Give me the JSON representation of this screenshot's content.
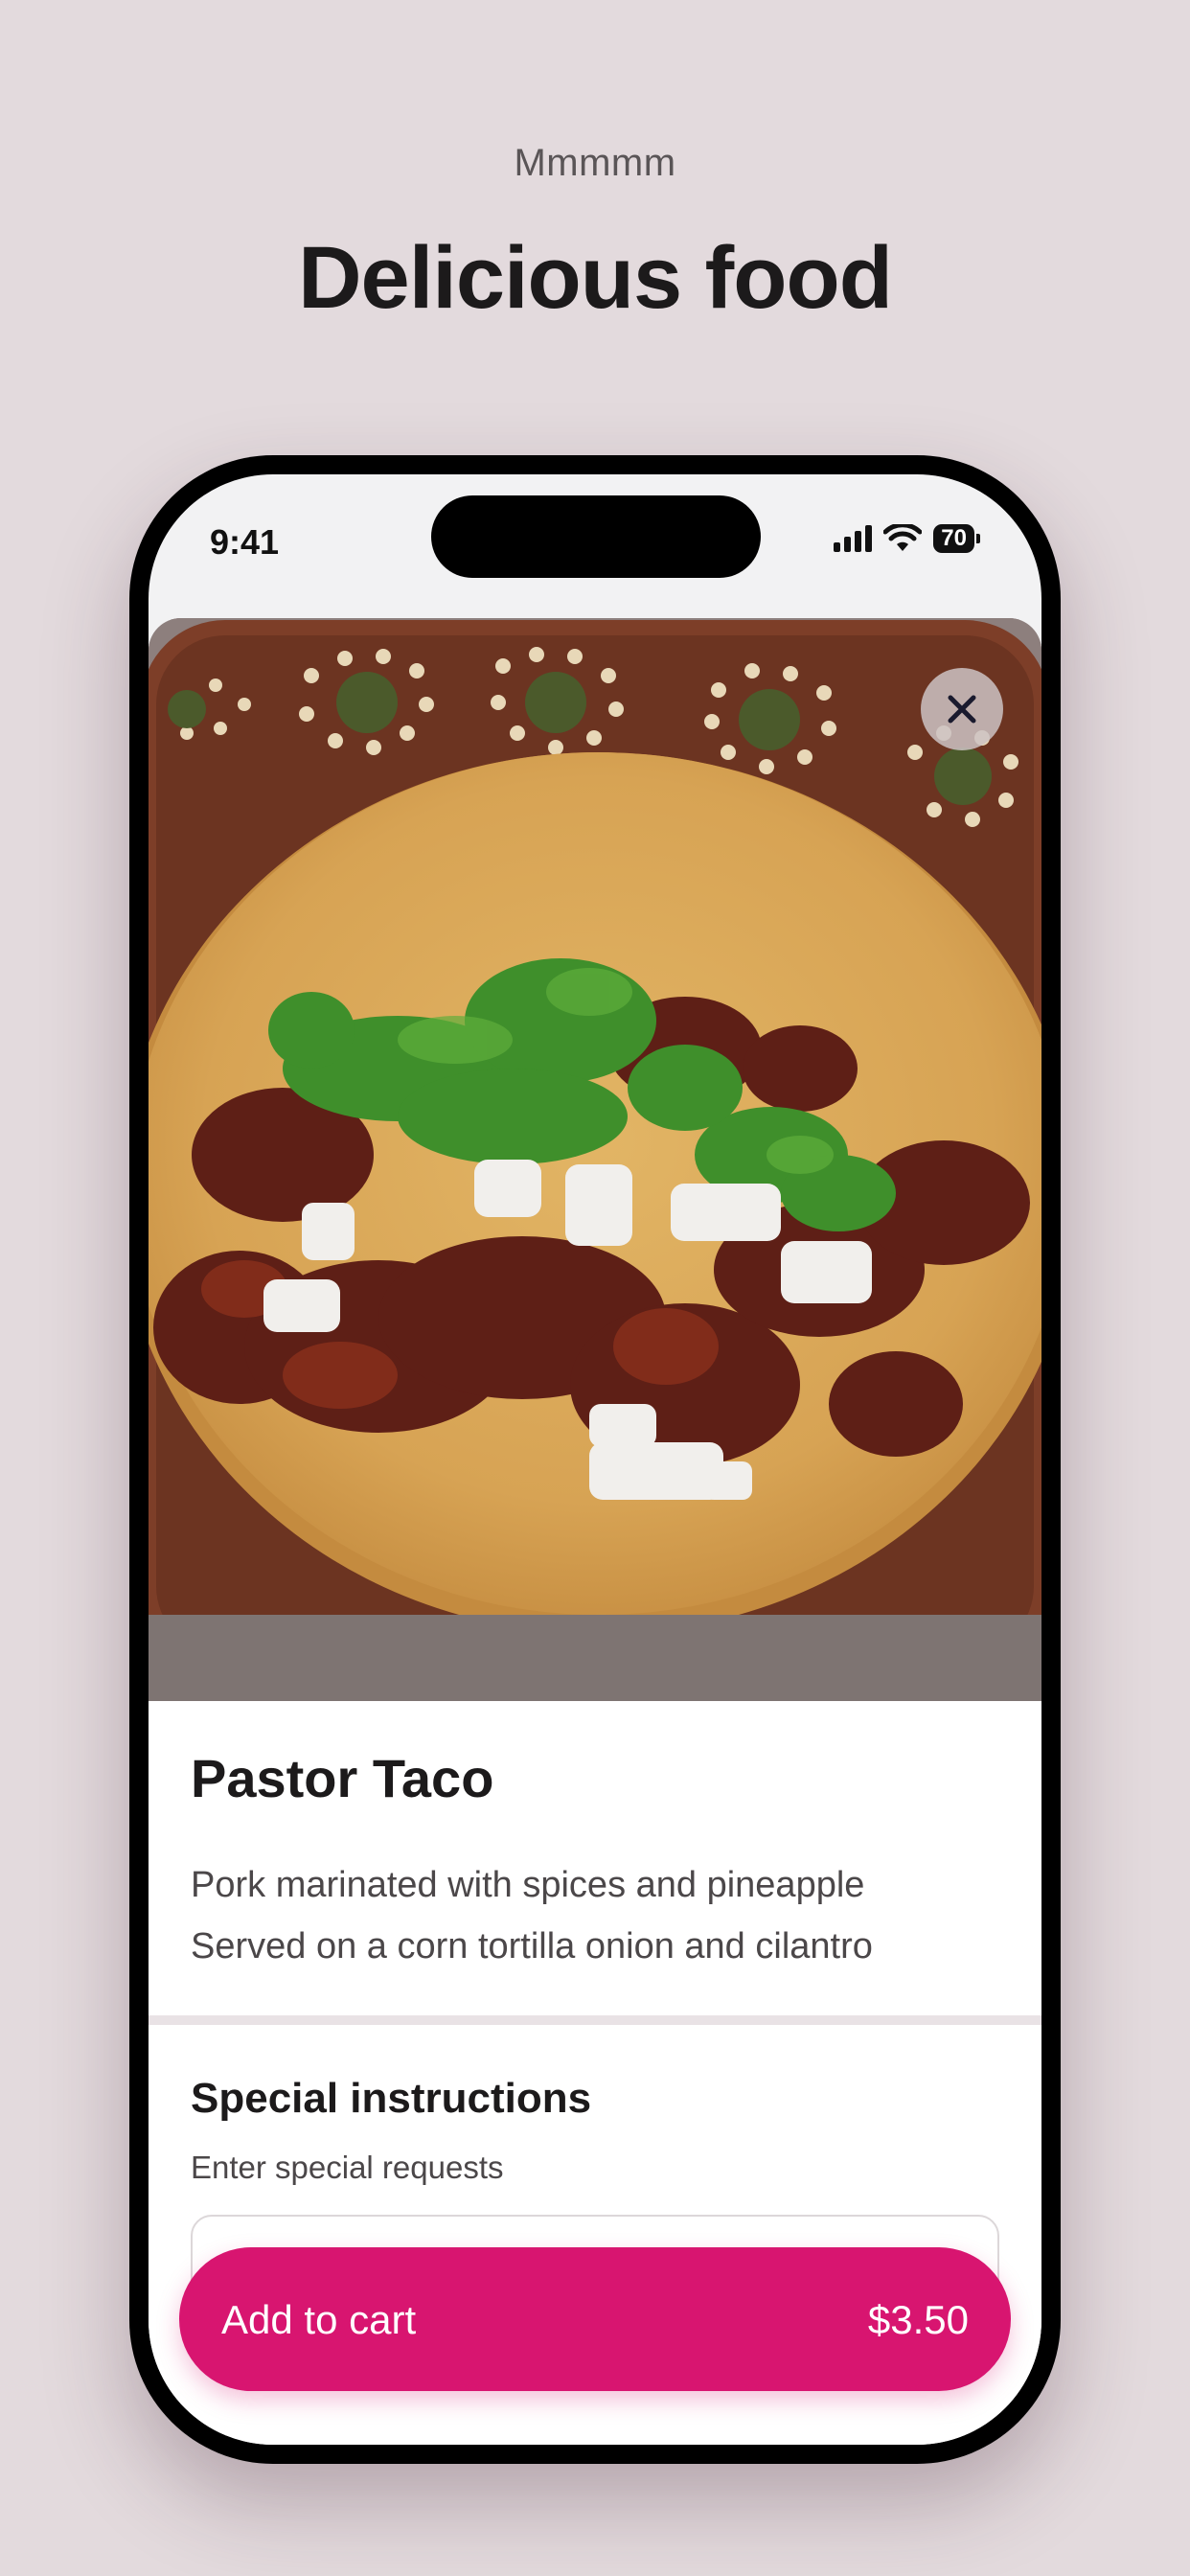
{
  "page": {
    "eyebrow": "Mmmmm",
    "headline": "Delicious food"
  },
  "status_bar": {
    "time": "9:41",
    "battery": "70",
    "icons": [
      "signal-icon",
      "wifi-icon",
      "battery-icon"
    ]
  },
  "item": {
    "image_alt": "Pastor taco on a clay plate",
    "title": "Pastor Taco",
    "description_lines": [
      "Pork marinated with spices and pineapple",
      "Served on a corn tortilla onion and cilantro"
    ]
  },
  "special_instructions": {
    "title": "Special instructions",
    "hint": "Enter special requests",
    "value": ""
  },
  "cart": {
    "label": "Add to cart",
    "price": "$3.50"
  },
  "colors": {
    "background": "#e3dadd",
    "accent": "#d81570",
    "text": "#1c1a1b"
  }
}
